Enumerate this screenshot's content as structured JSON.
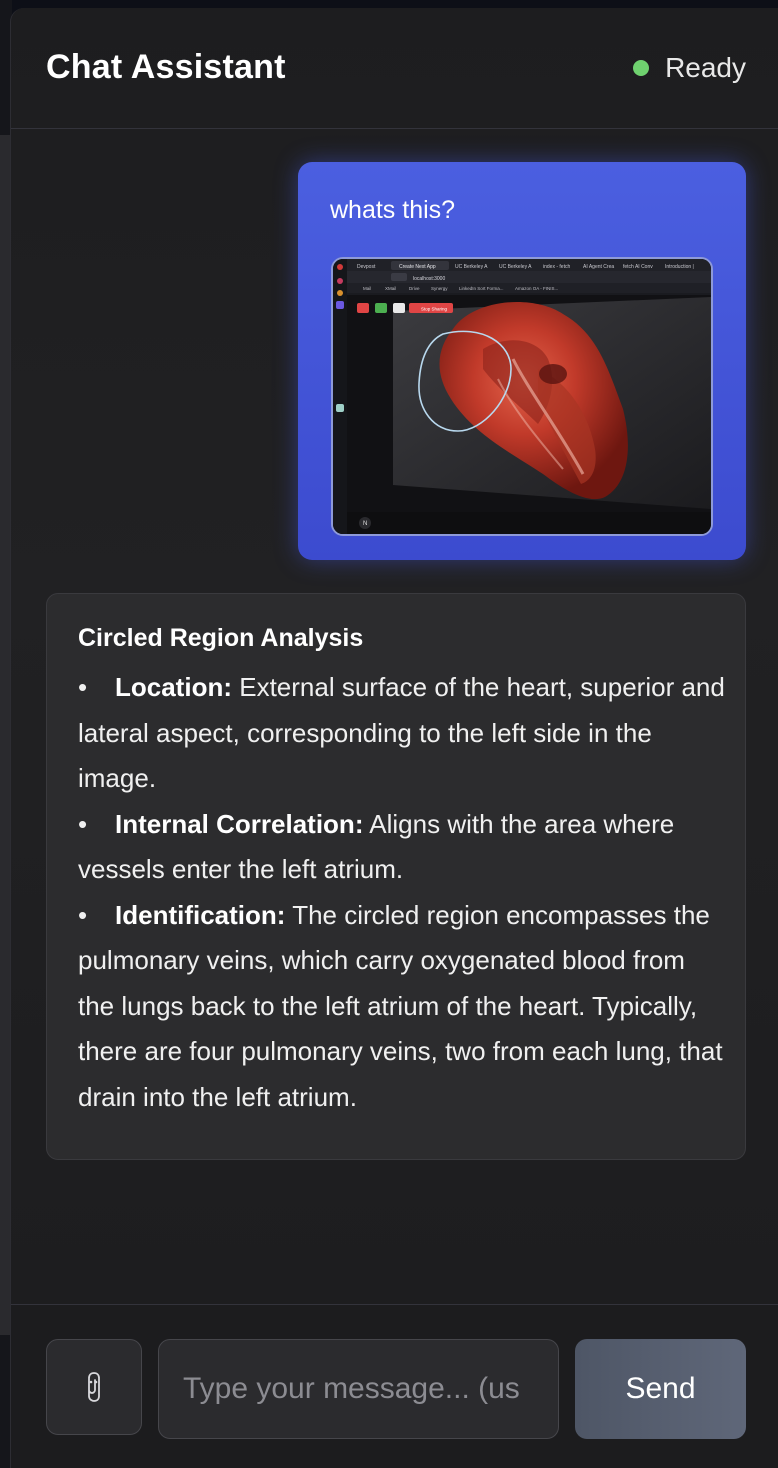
{
  "header": {
    "title": "Chat Assistant",
    "status": "Ready",
    "status_color": "#6fd16f"
  },
  "messages": {
    "user": {
      "text": "whats this?",
      "attachment_icon": "heart-3d-screenshot",
      "attachment_tabs": [
        "Devpost",
        "Create Next App",
        "UC Berkeley A",
        "UC Berkeley A",
        "index - fetch",
        "AI Agent Crea",
        "fetch AI Conv",
        "Introduction |"
      ],
      "attachment_url": "localhost:3000",
      "attachment_bookmarks": [
        "Mail",
        "XMail",
        "Drive",
        "Synergy",
        "LinkedIn Sort Forma...",
        "Amazon OA - FINIS..."
      ],
      "attachment_stop_label": "Stop Sharing"
    },
    "assistant": {
      "heading": "Circled Region Analysis",
      "items": [
        {
          "label": "Location:",
          "text": "External surface of the heart, superior and lateral aspect, corresponding to the left side in the image."
        },
        {
          "label": "Internal Correlation:",
          "text": "Aligns with the area where vessels enter the left atrium."
        },
        {
          "label": "Identification:",
          "text": "The circled region encompasses the pulmonary veins, which carry oxygenated blood from the lungs back to the left atrium of the heart. Typically, there are four pulmonary veins, two from each lung, that drain into the left atrium."
        }
      ]
    }
  },
  "composer": {
    "attach_icon": "paperclip-icon",
    "placeholder": "Type your message... (us",
    "send_label": "Send"
  },
  "colors": {
    "user_bubble": "#4356d8",
    "assistant_bubble": "#2c2c2e",
    "background": "#1e1e20"
  }
}
